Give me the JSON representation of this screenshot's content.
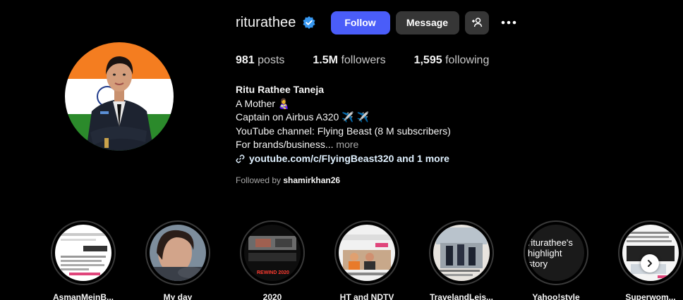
{
  "profile": {
    "username": "riturathee",
    "verified": true,
    "follow_label": "Follow",
    "message_label": "Message",
    "add_user_icon": "add-user-icon",
    "more_icon": "more-icon"
  },
  "stats": {
    "posts_count": "981",
    "posts_label": "posts",
    "followers_count": "1.5M",
    "followers_label": "followers",
    "following_count": "1,595",
    "following_label": "following"
  },
  "bio": {
    "full_name": "Ritu Rathee Taneja",
    "line1": "A Mother 👩‍🍼",
    "line2": "Captain on Airbus A320 ✈️ ✈️",
    "line3": "YouTube channel: Flying Beast (8 M subscribers)",
    "line4": "For brands/business...",
    "more": "more",
    "link": "youtube.com/c/FlyingBeast320 and 1 more"
  },
  "followed_by": {
    "prefix": "Followed by",
    "user": "shamirkhan26"
  },
  "highlights": [
    {
      "label": "AsmanMeinB..."
    },
    {
      "label": "My day"
    },
    {
      "label": "2020",
      "thumb_text": "REWIND 2020"
    },
    {
      "label": "HT and NDTV"
    },
    {
      "label": "TravelandLeis..."
    },
    {
      "label": "Yahoo!style",
      "thumb_text": "riturathee's highlight story"
    },
    {
      "label": "Superwom..."
    }
  ],
  "colors": {
    "background": "#000000",
    "follow_button": "#4a5df9",
    "secondary_button": "#363636",
    "verified_badge": "#3797f0",
    "link_text": "#e0f1ff"
  }
}
